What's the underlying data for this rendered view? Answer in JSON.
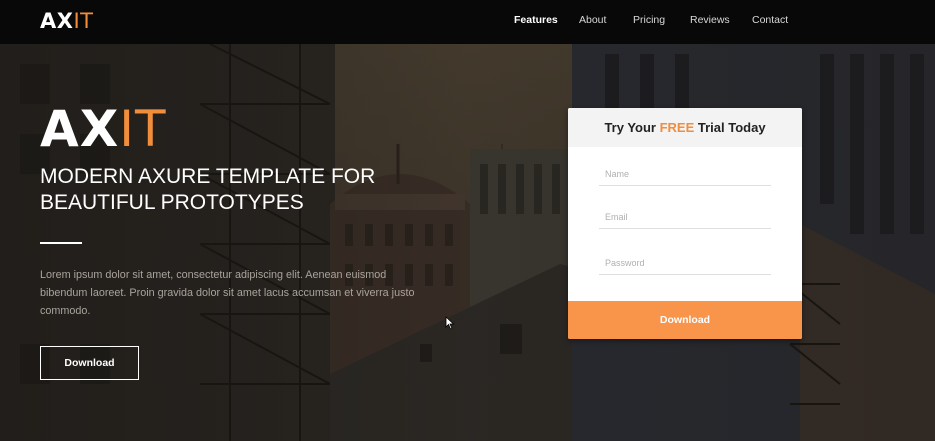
{
  "logo": {
    "a": "AX",
    "b": "IT"
  },
  "nav": {
    "items": [
      {
        "label": "Features"
      },
      {
        "label": "About"
      },
      {
        "label": "Pricing"
      },
      {
        "label": "Reviews"
      },
      {
        "label": "Contact"
      }
    ]
  },
  "hero": {
    "logo_a": "AX",
    "logo_b": "IT",
    "headline_line1": "MODERN AXURE TEMPLATE FOR",
    "headline_line2": "BEAUTIFUL PROTOTYPES",
    "description": "Lorem ipsum dolor sit amet, consectetur adipiscing elit. Aenean euismod bibendum laoreet. Proin gravida dolor sit amet lacus accumsan et viverra justo commodo.",
    "download_label": "Download"
  },
  "trial": {
    "title_before": "Try Your ",
    "title_free": "FREE",
    "title_after": " Trial Today",
    "name_placeholder": "Name",
    "email_placeholder": "Email",
    "password_placeholder": "Password",
    "download_label": "Download"
  },
  "colors": {
    "accent": "#f28d3c",
    "button": "#f9944b",
    "topbar": "#080808"
  }
}
